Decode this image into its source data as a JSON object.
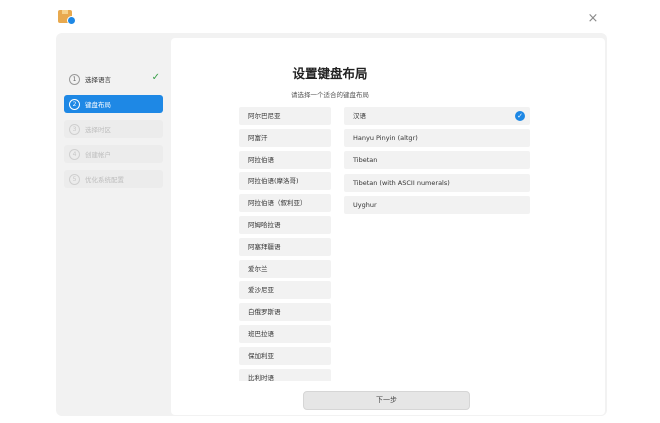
{
  "sidebar": {
    "steps": [
      {
        "num": "1",
        "label": "选择语言",
        "check": "✓"
      },
      {
        "num": "2",
        "label": "键盘布局"
      },
      {
        "num": "3",
        "label": "选择时区"
      },
      {
        "num": "4",
        "label": "创建帐户"
      },
      {
        "num": "5",
        "label": "优化系统配置"
      }
    ]
  },
  "main": {
    "title": "设置键盘布局",
    "subtitle": "请选择一个适合的键盘布局",
    "languages": [
      "阿尔巴尼亚",
      "阿富汗",
      "阿拉伯语",
      "阿拉伯语(摩洛哥)",
      "阿拉伯语（叙利亚）",
      "阿姆哈拉语",
      "阿塞拜疆语",
      "爱尔兰",
      "爱沙尼亚",
      "白俄罗斯语",
      "班巴拉语",
      "保加利亚",
      "比利时语"
    ],
    "layouts": [
      "汉语",
      "Hanyu Pinyin (altgr)",
      "Tibetan",
      "Tibetan (with ASCII numerals)",
      "Uyghur"
    ],
    "selected_check": "✓"
  },
  "footer": {
    "next_label": "下一步"
  },
  "window": {
    "close_glyph": "×"
  },
  "colors": {
    "accent": "#1e88e5",
    "panel": "#f2f2f2",
    "success": "#3aa04a"
  },
  "icons": {
    "app": "installer-app-icon",
    "close": "close-icon",
    "check": "checkmark-icon"
  }
}
